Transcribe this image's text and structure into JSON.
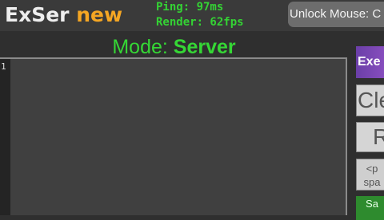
{
  "header": {
    "logo_main": "ExSer",
    "logo_accent": "new",
    "ping": "Ping: 97ms",
    "render": "Render: 62fps",
    "unlock_label": "Unlock Mouse: C"
  },
  "mode": {
    "label": "Mode:",
    "value": "Server"
  },
  "editor": {
    "line_numbers": [
      "1"
    ]
  },
  "side_buttons": {
    "execute": "Exe",
    "clear": "Cle",
    "r": "R",
    "snippet_line1": "<p",
    "snippet_line2": "spa",
    "save": "Sa"
  },
  "colors": {
    "accent_green": "#35d735",
    "logo_orange": "#f5a623",
    "execute_purple": "#7a48b4",
    "save_green": "#2e8b2e"
  },
  "icons": []
}
